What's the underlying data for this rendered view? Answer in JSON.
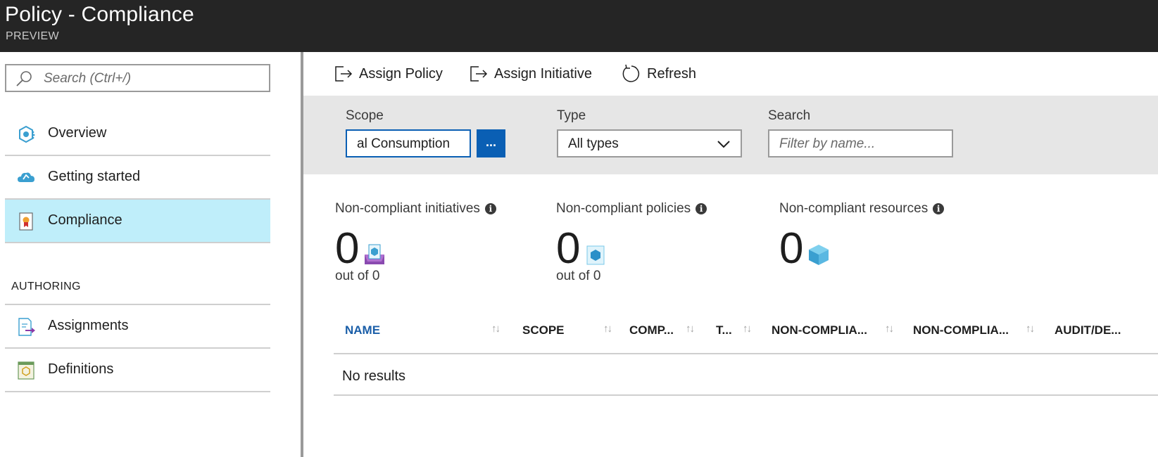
{
  "header": {
    "title": "Policy - Compliance",
    "subtitle": "PREVIEW"
  },
  "sidebar": {
    "search_placeholder": "Search (Ctrl+/)",
    "items": [
      {
        "label": "Overview",
        "icon": "overview-icon"
      },
      {
        "label": "Getting started",
        "icon": "cloud-icon"
      },
      {
        "label": "Compliance",
        "icon": "certificate-icon",
        "active": true
      }
    ],
    "section": "AUTHORING",
    "authoring_items": [
      {
        "label": "Assignments",
        "icon": "assignment-icon"
      },
      {
        "label": "Definitions",
        "icon": "definition-icon"
      }
    ]
  },
  "toolbar": {
    "assign_policy": "Assign Policy",
    "assign_initiative": "Assign Initiative",
    "refresh": "Refresh"
  },
  "filters": {
    "scope_label": "Scope",
    "scope_value": "al Consumption",
    "scope_button": "...",
    "type_label": "Type",
    "type_value": "All types",
    "search_label": "Search",
    "search_placeholder": "Filter by name..."
  },
  "summary": {
    "initiatives": {
      "label": "Non-compliant initiatives",
      "count": "0",
      "outof": "out of 0"
    },
    "policies": {
      "label": "Non-compliant policies",
      "count": "0",
      "outof": "out of 0"
    },
    "resources": {
      "label": "Non-compliant resources",
      "count": "0"
    }
  },
  "table": {
    "columns": [
      "NAME",
      "SCOPE",
      "COMP...",
      "T...",
      "NON-COMPLIA...",
      "NON-COMPLIA...",
      "AUDIT/DE..."
    ],
    "empty": "No results"
  },
  "colors": {
    "accent": "#0a5fb4",
    "active_nav": "#bfeefa",
    "header_bg": "#252525"
  }
}
